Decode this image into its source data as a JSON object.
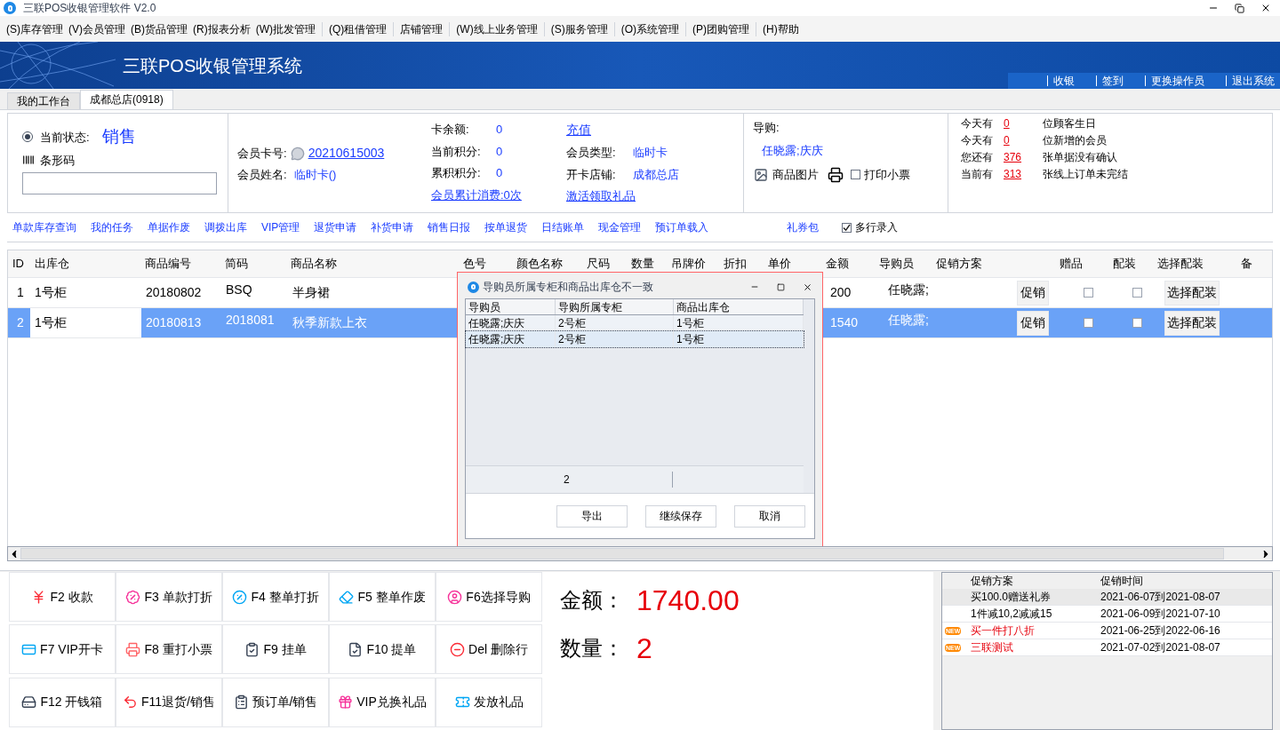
{
  "window": {
    "title": "三联POS收银管理软件 V2.0"
  },
  "menu": [
    "(S)库存管理",
    "(V)会员管理",
    "(B)货品管理",
    "(R)报表分析",
    "(W)批发管理",
    "(Q)租借管理",
    "店铺管理",
    "(W)线上业务管理",
    "(S)服务管理",
    "(O)系统管理",
    "(P)团购管理",
    "(H)帮助"
  ],
  "banner": {
    "title": "三联POS收银管理系统",
    "links": [
      "收银",
      "签到",
      "更换操作员",
      "退出系统"
    ]
  },
  "tabs": [
    {
      "label": "我的工作台",
      "selected": false
    },
    {
      "label": "成都总店(0918)",
      "selected": true
    }
  ],
  "status": {
    "label": "当前状态:",
    "value": "销售",
    "selected": true,
    "barcode_label": "条形码"
  },
  "member": {
    "card_label": "会员卡号:",
    "card_no": "20210615003",
    "name_label": "会员姓名:",
    "name": "临时卡()",
    "stats": [
      {
        "label": "卡余额:",
        "value": "0"
      },
      {
        "label": "当前积分:",
        "value": "0"
      },
      {
        "label": "累积积分:",
        "value": "0"
      }
    ],
    "consumption_link": "会员累计消费:0次",
    "recharge_link": "充值",
    "details": [
      {
        "label": "会员类型:",
        "value": "临时卡"
      },
      {
        "label": "开卡店铺:",
        "value": "成都总店"
      }
    ],
    "gift_link": "激活领取礼品"
  },
  "guide": {
    "label": "导购:",
    "value": "任晓露;庆庆",
    "image_label": "商品图片",
    "print": {
      "label": "打印小票",
      "checked": false
    }
  },
  "notices": [
    {
      "prefix": "今天有",
      "count": "0",
      "suffix": "位顾客生日"
    },
    {
      "prefix": "今天有",
      "count": "0",
      "suffix": "位新增的会员"
    },
    {
      "prefix": "您还有",
      "count": "376",
      "suffix": "张单据没有确认"
    },
    {
      "prefix": "当前有",
      "count": "313",
      "suffix": "张线上订单未完结"
    }
  ],
  "quick_links": [
    "单款库存查询",
    "我的任务",
    "单据作废",
    "调拨出库",
    "VIP管理",
    "退货申请",
    "补货申请",
    "销售日报",
    "按单退货",
    "日结账单",
    "现金管理",
    "预订单载入"
  ],
  "coupon_link": "礼券包",
  "multi_entry": {
    "label": "多行录入",
    "checked": true
  },
  "table": {
    "columns": [
      "ID",
      "出库仓",
      "商品编号",
      "简码",
      "商品名称",
      "色号",
      "颜色名称",
      "尺码",
      "数量",
      "吊牌价",
      "折扣",
      "单价",
      "金额",
      "导购员",
      "促销方案",
      "赠品",
      "配装",
      "选择配装",
      "备"
    ],
    "rows": [
      {
        "selected": false,
        "id": "1",
        "warehouse": "1号柜",
        "code": "20180802",
        "short_code": "BSQ",
        "name": "半身裙",
        "amount": "200",
        "guide": "任晓露;",
        "promo_button": "促销",
        "gift": false,
        "assembly": false,
        "choose_button": "选择配装"
      },
      {
        "selected": true,
        "id": "2",
        "warehouse": "1号柜",
        "code": "20180813",
        "short_code": "2018081",
        "name": "秋季新款上衣",
        "amount": "1540",
        "guide": "任晓露;",
        "promo_button": "促销",
        "gift": false,
        "assembly": false,
        "choose_button": "选择配装"
      }
    ]
  },
  "dialog": {
    "title": "导购员所属专柜和商品出库仓不一致",
    "columns": [
      "导购员",
      "导购所属专柜",
      "商品出库仓"
    ],
    "rows": [
      {
        "selected": false,
        "cells": [
          "任晓露;庆庆",
          "2号柜",
          "1号柜"
        ]
      },
      {
        "selected": true,
        "cells": [
          "任晓露;庆庆",
          "2号柜",
          "1号柜"
        ]
      }
    ],
    "footer": "2",
    "buttons": [
      "导出",
      "继续保存",
      "取消"
    ]
  },
  "function_keys": [
    "F2 收款",
    "F3 单款打折",
    "F4 整单打折",
    "F5 整单作废",
    "F6选择导购",
    "F7 VIP开卡",
    "F8 重打小票",
    "F9 挂单",
    "F10 提单",
    "Del 删除行",
    "F12 开钱箱",
    "F11退货/销售",
    "预订单/销售",
    "VIP兑换礼品",
    "发放礼品"
  ],
  "totals": [
    {
      "label": "金额：",
      "value": "1740.00"
    },
    {
      "label": "数量：",
      "value": "2"
    }
  ],
  "promotions": {
    "columns": [
      "促销方案",
      "促销时间"
    ],
    "rows": [
      {
        "selected": true,
        "new": false,
        "name": "买100.0赠送礼券",
        "period": "2021-06-07到2021-08-07"
      },
      {
        "selected": false,
        "new": false,
        "name": "1件减10,2减减15",
        "period": "2021-06-09到2021-07-10"
      },
      {
        "selected": false,
        "new": true,
        "badge": "NEW",
        "name": "买一件打八折",
        "period": "2021-06-25到2022-06-16"
      },
      {
        "selected": false,
        "new": true,
        "badge": "NEW",
        "name": "三联测试",
        "period": "2021-07-02到2021-08-07"
      }
    ]
  }
}
